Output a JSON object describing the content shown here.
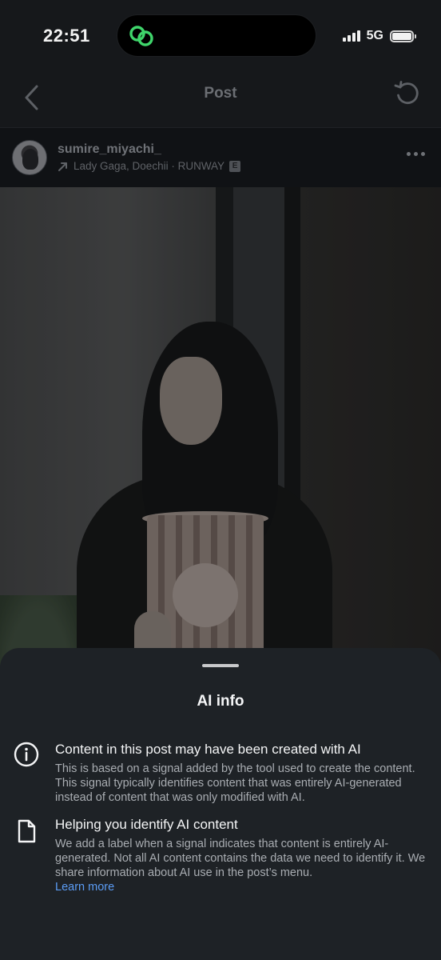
{
  "status_bar": {
    "time": "22:51",
    "network": "5G",
    "icons": [
      "chain-link-icon",
      "signal-bars-icon",
      "battery-icon"
    ],
    "island_accent": "#3fd56b"
  },
  "nav": {
    "title": "Post",
    "back_icon": "chevron-left-icon",
    "refresh_icon": "refresh-icon"
  },
  "post": {
    "username": "sumire_miyachi_",
    "audio_icon": "arrow-up-right-icon",
    "audio": "Lady Gaga, Doechii · RUNWAY",
    "explicit_badge": "E",
    "more_icon": "more-dots-icon"
  },
  "sheet": {
    "title": "AI info",
    "rows": [
      {
        "icon": "info-circle-icon",
        "title": "Content in this post may have been created with AI",
        "body": "This is based on a signal added by the tool used to create the content. This signal typically identifies content that was entirely AI-generated instead of content that was only modified with AI."
      },
      {
        "icon": "document-icon",
        "title": "Helping you identify AI content",
        "body": "We add a label when a signal indicates that content is entirely AI-generated. Not all AI content contains the data we need to identify it. We share information about AI use in the post’s menu.",
        "link": "Learn more"
      }
    ]
  },
  "colors": {
    "background": "#0b0d10",
    "sheet": "#1e2226",
    "link": "#5b9cf4"
  }
}
